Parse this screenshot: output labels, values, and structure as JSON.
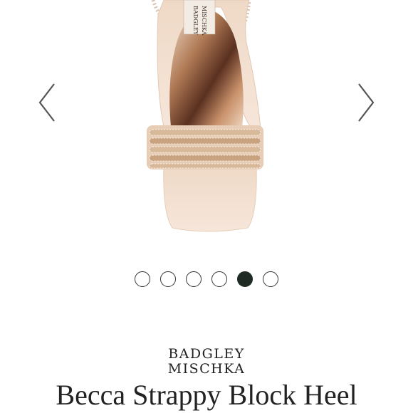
{
  "gallery": {
    "image_alt": "Badgley Mischka rose gold sandal with crystal straps",
    "insole_logo": [
      "BADGLEY",
      "MISCHKA"
    ],
    "prev_icon": "chevron-left-icon",
    "next_icon": "chevron-right-icon",
    "dots_total": 6,
    "active_dot_index": 5
  },
  "product": {
    "brand_line1": "BADGLEY",
    "brand_line2": "MISCHKA",
    "title": "Becca Strappy Block Heel"
  },
  "colors": {
    "dot_active": "#1e2a22",
    "text": "#222222",
    "shoe_rose_gold": "#e8cdb6"
  }
}
